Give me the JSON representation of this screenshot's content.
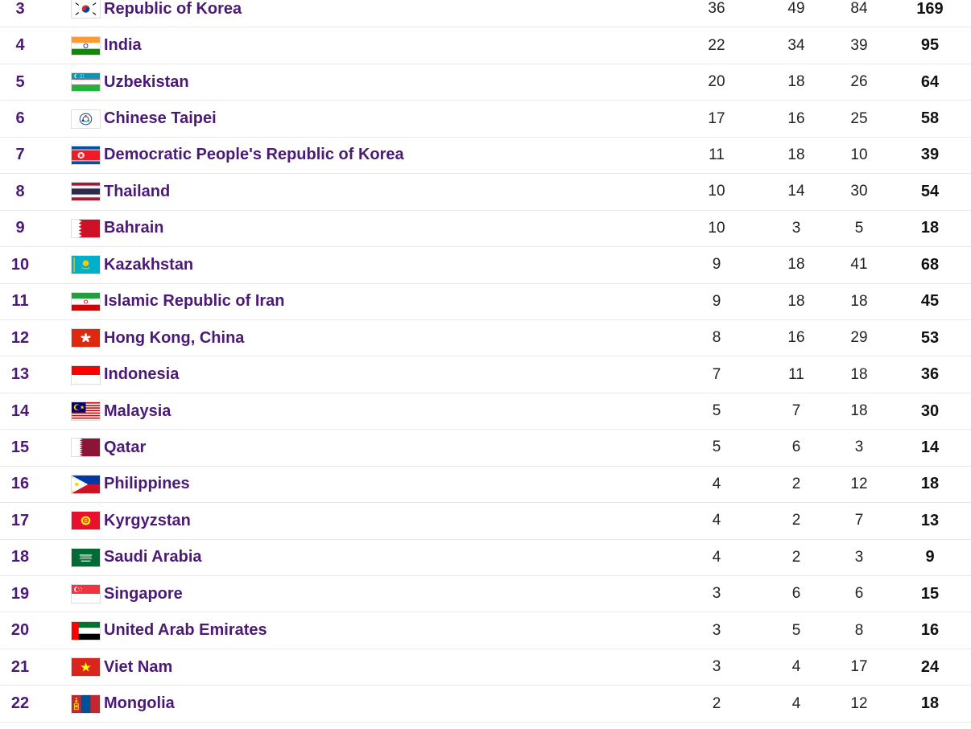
{
  "medal_table": {
    "rows": [
      {
        "rank": "3",
        "country": "Republic of Korea",
        "flag": "kr-flag-icon",
        "gold": "36",
        "silver": "49",
        "bronze": "84",
        "total": "169"
      },
      {
        "rank": "4",
        "country": "India",
        "flag": "in-flag-icon",
        "gold": "22",
        "silver": "34",
        "bronze": "39",
        "total": "95"
      },
      {
        "rank": "5",
        "country": "Uzbekistan",
        "flag": "uz-flag-icon",
        "gold": "20",
        "silver": "18",
        "bronze": "26",
        "total": "64"
      },
      {
        "rank": "6",
        "country": "Chinese Taipei",
        "flag": "tpe-flag-icon",
        "gold": "17",
        "silver": "16",
        "bronze": "25",
        "total": "58"
      },
      {
        "rank": "7",
        "country": "Democratic People's Republic of Korea",
        "flag": "kp-flag-icon",
        "gold": "11",
        "silver": "18",
        "bronze": "10",
        "total": "39"
      },
      {
        "rank": "8",
        "country": "Thailand",
        "flag": "th-flag-icon",
        "gold": "10",
        "silver": "14",
        "bronze": "30",
        "total": "54"
      },
      {
        "rank": "9",
        "country": "Bahrain",
        "flag": "bh-flag-icon",
        "gold": "10",
        "silver": "3",
        "bronze": "5",
        "total": "18"
      },
      {
        "rank": "10",
        "country": "Kazakhstan",
        "flag": "kz-flag-icon",
        "gold": "9",
        "silver": "18",
        "bronze": "41",
        "total": "68"
      },
      {
        "rank": "11",
        "country": "Islamic Republic of Iran",
        "flag": "ir-flag-icon",
        "gold": "9",
        "silver": "18",
        "bronze": "18",
        "total": "45"
      },
      {
        "rank": "12",
        "country": "Hong Kong, China",
        "flag": "hk-flag-icon",
        "gold": "8",
        "silver": "16",
        "bronze": "29",
        "total": "53"
      },
      {
        "rank": "13",
        "country": "Indonesia",
        "flag": "id-flag-icon",
        "gold": "7",
        "silver": "11",
        "bronze": "18",
        "total": "36"
      },
      {
        "rank": "14",
        "country": "Malaysia",
        "flag": "my-flag-icon",
        "gold": "5",
        "silver": "7",
        "bronze": "18",
        "total": "30"
      },
      {
        "rank": "15",
        "country": "Qatar",
        "flag": "qa-flag-icon",
        "gold": "5",
        "silver": "6",
        "bronze": "3",
        "total": "14"
      },
      {
        "rank": "16",
        "country": "Philippines",
        "flag": "ph-flag-icon",
        "gold": "4",
        "silver": "2",
        "bronze": "12",
        "total": "18"
      },
      {
        "rank": "17",
        "country": "Kyrgyzstan",
        "flag": "kg-flag-icon",
        "gold": "4",
        "silver": "2",
        "bronze": "7",
        "total": "13"
      },
      {
        "rank": "18",
        "country": "Saudi Arabia",
        "flag": "sa-flag-icon",
        "gold": "4",
        "silver": "2",
        "bronze": "3",
        "total": "9"
      },
      {
        "rank": "19",
        "country": "Singapore",
        "flag": "sg-flag-icon",
        "gold": "3",
        "silver": "6",
        "bronze": "6",
        "total": "15"
      },
      {
        "rank": "20",
        "country": "United Arab Emirates",
        "flag": "ae-flag-icon",
        "gold": "3",
        "silver": "5",
        "bronze": "8",
        "total": "16"
      },
      {
        "rank": "21",
        "country": "Viet Nam",
        "flag": "vn-flag-icon",
        "gold": "3",
        "silver": "4",
        "bronze": "17",
        "total": "24"
      },
      {
        "rank": "22",
        "country": "Mongolia",
        "flag": "mn-flag-icon",
        "gold": "2",
        "silver": "4",
        "bronze": "12",
        "total": "18"
      }
    ]
  },
  "colors": {
    "country_link": "#4b1a74",
    "row_divider": "#e8e8e8"
  }
}
